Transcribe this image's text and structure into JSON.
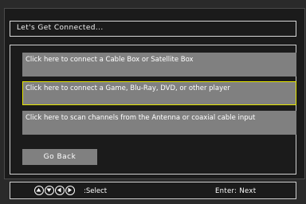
{
  "dialog": {
    "title": "Let's Get Connected..."
  },
  "options": [
    {
      "label": "Click here to connect a Cable Box or Satellite Box",
      "selected": false
    },
    {
      "label": "Click here to connect a Game, Blu-Ray, DVD, or other player",
      "selected": true
    },
    {
      "label": "Click here to scan channels from the Antenna or coaxial cable input",
      "selected": false
    }
  ],
  "back_button": {
    "label": "Go Back"
  },
  "footer": {
    "nav_icons": [
      "up-arrow-icon",
      "down-arrow-icon",
      "left-arrow-icon",
      "right-arrow-icon"
    ],
    "select_label": ":Select",
    "enter_label": "Enter: Next"
  },
  "colors": {
    "background": "#1b1b1b",
    "button": "#808080",
    "highlight": "#e6e600",
    "text": "#ffffff"
  }
}
